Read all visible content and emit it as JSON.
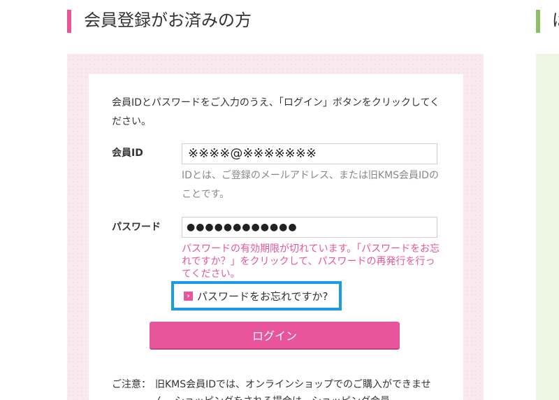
{
  "header": {
    "title": "会員登録がお済みの方",
    "right_title_partial": "は"
  },
  "login_form": {
    "intro": "会員IDとパスワードをご入力のうえ、「ログイン」ボタンをクリックしてください。",
    "id_label": "会員ID",
    "id_value": "※※※※@※※※※※※※",
    "id_hint": "IDとは、ご登録のメールアドレス、または旧KMS会員IDのことです。",
    "password_label": "パスワード",
    "password_value": "●●●●●●●●●●●●",
    "password_error": "パスワードの有効期限が切れています。「パスワードをお忘れですか？」をクリックして、パスワードの再発行を行ってください。",
    "forgot_link": "パスワードをお忘れですか?",
    "login_button": "ログイン",
    "notice_label": "ご注意：",
    "notice_text": "旧KMS会員IDでは、オンラインショップでのご購入ができません。ショッピングをされる場合は、ショッピング会員"
  },
  "colors": {
    "accent_pink": "#e8559a",
    "accent_green": "#8cc063",
    "highlight_blue": "#1b9be4"
  },
  "icons": {
    "forgot_arrow": "chevron-right-icon"
  }
}
